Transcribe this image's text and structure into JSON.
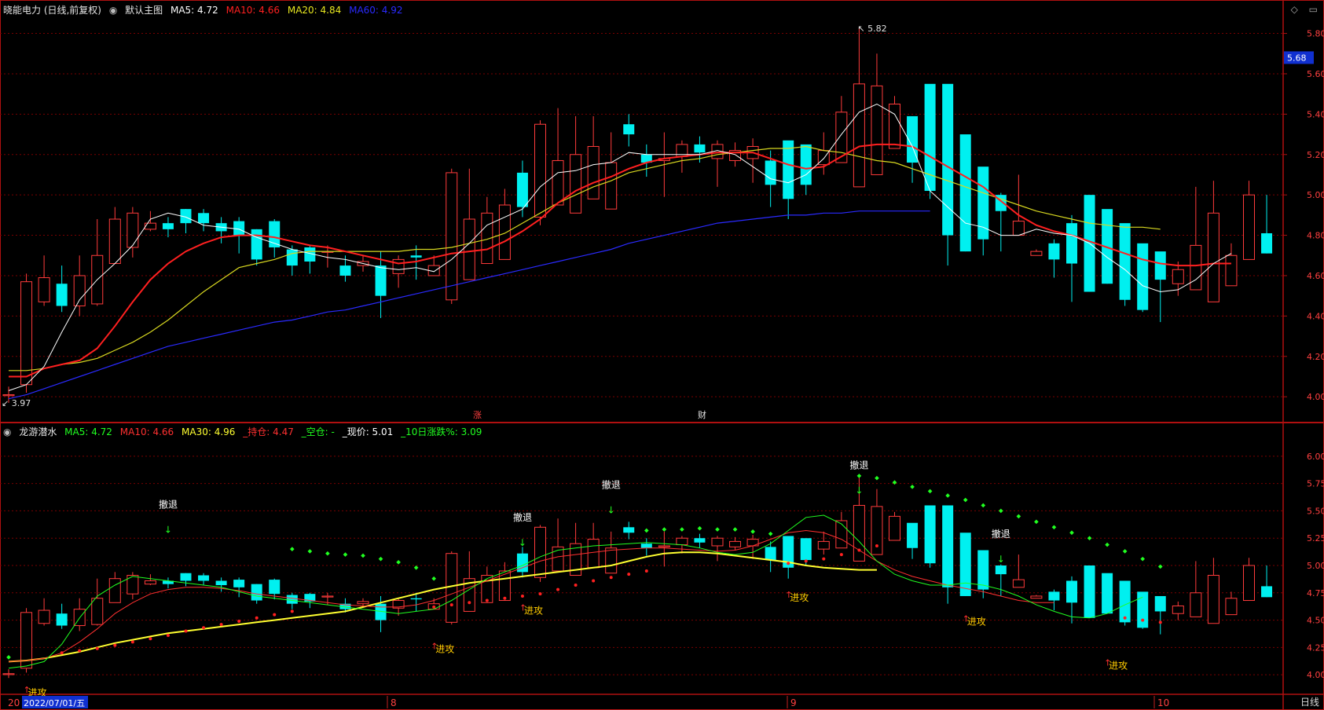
{
  "panel1": {
    "stock": "晓能电力 (日线,前复权)",
    "main_label": "默认主图",
    "ma": [
      {
        "label": "MA5: 4.72",
        "color": "#ffffff"
      },
      {
        "label": "MA10: 4.66",
        "color": "#ff2020"
      },
      {
        "label": "MA20: 4.84",
        "color": "#e8e820"
      },
      {
        "label": "MA60: 4.92",
        "color": "#2a2aff"
      }
    ],
    "markers": {
      "high": "5.82",
      "low": "3.97",
      "zhang": "涨",
      "cai": "财"
    },
    "price_tag": "5.68"
  },
  "panel2": {
    "title": "龙游潜水",
    "items": [
      {
        "label": "MA5: 4.72",
        "color": "#20ff20"
      },
      {
        "label": "MA10: 4.66",
        "color": "#ff3030"
      },
      {
        "label": "MA30: 4.96",
        "color": "#ffff30"
      },
      {
        "label": "_持仓: 4.47",
        "color": "#ff3030"
      },
      {
        "label": "_空仓: -",
        "color": "#20ff20"
      },
      {
        "label": "_现价: 5.01",
        "color": "#ffffff"
      },
      {
        "label": "_10日涨跌%: 3.09",
        "color": "#20ff20"
      }
    ],
    "attack": "进攻",
    "retreat": "撤退"
  },
  "xaxis": {
    "date": "2022/07/01/五",
    "months": [
      "8",
      "9",
      "10"
    ],
    "left_stub": "20"
  },
  "mode": "日线",
  "colors": {
    "up": "#ff3b3b",
    "down": "#00f0f0",
    "frame": "#b01010"
  },
  "chart_data": [
    {
      "type": "candlestick",
      "title": "晓能电力 (日线,前复权)",
      "ylim": [
        3.88,
        5.88
      ],
      "yticks": [
        4.0,
        4.2,
        4.4,
        4.6,
        4.8,
        5.0,
        5.2,
        5.4,
        5.6,
        5.8
      ],
      "x": [
        1,
        2,
        3,
        4,
        5,
        6,
        7,
        8,
        9,
        10,
        11,
        12,
        13,
        14,
        15,
        16,
        17,
        18,
        19,
        20,
        21,
        22,
        23,
        24,
        25,
        26,
        27,
        28,
        29,
        30,
        31,
        32,
        33,
        34,
        35,
        36,
        37,
        38,
        39,
        40,
        41,
        42,
        43,
        44,
        45,
        46,
        47,
        48,
        49,
        50,
        51,
        52,
        53,
        54,
        55,
        56,
        57,
        58,
        59,
        60,
        61,
        62,
        63,
        64,
        65,
        66,
        67,
        68,
        69,
        70,
        71,
        72
      ],
      "open": [
        4.01,
        4.06,
        4.47,
        4.56,
        4.45,
        4.46,
        4.66,
        4.74,
        4.83,
        4.86,
        4.93,
        4.91,
        4.86,
        4.87,
        4.83,
        4.87,
        4.73,
        4.74,
        4.72,
        4.65,
        4.65,
        4.65,
        4.61,
        4.7,
        4.6,
        4.48,
        4.58,
        4.66,
        4.68,
        5.11,
        4.89,
        4.95,
        4.91,
        4.98,
        4.93,
        5.35,
        5.2,
        5.17,
        5.19,
        5.25,
        5.18,
        5.17,
        5.18,
        5.17,
        5.27,
        5.25,
        5.15,
        5.16,
        5.04,
        5.1,
        5.23,
        5.39,
        5.55,
        5.55,
        5.3,
        5.14,
        5.0,
        4.8,
        4.7,
        4.76,
        4.86,
        5.0,
        4.93,
        4.86,
        4.76,
        4.72,
        4.56,
        4.53,
        4.47,
        4.55,
        4.68,
        4.81
      ],
      "close": [
        4.01,
        4.57,
        4.59,
        4.45,
        4.6,
        4.7,
        4.88,
        4.91,
        4.86,
        4.83,
        4.86,
        4.86,
        4.82,
        4.8,
        4.68,
        4.74,
        4.65,
        4.67,
        4.72,
        4.6,
        4.67,
        4.5,
        4.68,
        4.69,
        4.65,
        5.11,
        4.88,
        4.91,
        4.95,
        4.94,
        5.35,
        5.17,
        5.2,
        5.24,
        5.16,
        5.3,
        5.16,
        5.18,
        5.25,
        5.21,
        5.25,
        5.22,
        5.24,
        5.05,
        4.98,
        5.05,
        5.22,
        5.41,
        5.55,
        5.54,
        5.45,
        5.16,
        5.02,
        4.8,
        4.72,
        4.78,
        4.92,
        4.87,
        4.72,
        4.68,
        4.66,
        4.52,
        4.56,
        4.48,
        4.43,
        4.58,
        4.63,
        4.75,
        4.91,
        4.7,
        5.0,
        4.71
      ],
      "high": [
        4.05,
        4.61,
        4.7,
        4.65,
        4.7,
        4.88,
        4.94,
        4.94,
        4.92,
        4.89,
        4.93,
        4.93,
        4.89,
        4.89,
        4.83,
        4.88,
        4.75,
        4.75,
        4.75,
        4.7,
        4.7,
        4.72,
        4.7,
        4.75,
        4.7,
        5.13,
        5.13,
        4.99,
        5.03,
        5.17,
        5.37,
        5.43,
        5.39,
        5.39,
        5.31,
        5.4,
        5.25,
        5.31,
        5.27,
        5.29,
        5.27,
        5.26,
        5.28,
        5.22,
        5.25,
        5.11,
        5.31,
        5.49,
        5.83,
        5.7,
        5.49,
        5.3,
        5.1,
        4.87,
        4.8,
        4.89,
        5.01,
        5.1,
        4.73,
        4.78,
        4.9,
        4.74,
        4.66,
        4.54,
        4.49,
        4.68,
        4.67,
        5.04,
        5.07,
        4.76,
        5.07,
        5.0
      ],
      "low": [
        3.97,
        4.02,
        4.45,
        4.42,
        4.4,
        4.45,
        4.66,
        4.69,
        4.82,
        4.79,
        4.81,
        4.82,
        4.76,
        4.71,
        4.65,
        4.69,
        4.6,
        4.61,
        4.64,
        4.57,
        4.62,
        4.39,
        4.54,
        4.58,
        4.6,
        4.46,
        4.73,
        4.8,
        4.89,
        4.89,
        4.85,
        5.06,
        5.15,
        5.13,
        5.05,
        5.24,
        5.09,
        4.99,
        5.11,
        5.16,
        5.04,
        5.14,
        5.06,
        4.94,
        4.88,
        5.0,
        5.1,
        5.31,
        5.42,
        5.47,
        5.29,
        5.06,
        4.98,
        4.65,
        4.72,
        4.7,
        4.72,
        4.8,
        4.7,
        4.59,
        4.47,
        4.52,
        4.56,
        4.45,
        4.42,
        4.37,
        4.5,
        4.75,
        4.88,
        4.68,
        4.81,
        4.71
      ],
      "ma5": [
        4.03,
        4.06,
        4.15,
        4.32,
        4.48,
        4.58,
        4.66,
        4.75,
        4.88,
        4.91,
        4.89,
        4.85,
        4.84,
        4.83,
        4.79,
        4.76,
        4.73,
        4.71,
        4.69,
        4.68,
        4.66,
        4.64,
        4.63,
        4.64,
        4.62,
        4.68,
        4.76,
        4.85,
        4.89,
        4.93,
        5.04,
        5.11,
        5.12,
        5.15,
        5.16,
        5.21,
        5.2,
        5.2,
        5.2,
        5.2,
        5.22,
        5.2,
        5.14,
        5.08,
        5.06,
        5.1,
        5.18,
        5.3,
        5.41,
        5.45,
        5.4,
        5.24,
        5.02,
        4.94,
        4.86,
        4.84,
        4.8,
        4.8,
        4.83,
        4.81,
        4.8,
        4.76,
        4.69,
        4.63,
        4.55,
        4.52,
        4.53,
        4.58,
        4.66,
        4.71
      ],
      "ma10": [
        4.1,
        4.1,
        4.14,
        4.16,
        4.18,
        4.24,
        4.35,
        4.47,
        4.58,
        4.66,
        4.72,
        4.76,
        4.79,
        4.8,
        4.8,
        4.79,
        4.77,
        4.75,
        4.74,
        4.72,
        4.7,
        4.68,
        4.66,
        4.67,
        4.69,
        4.71,
        4.72,
        4.73,
        4.77,
        4.82,
        4.88,
        4.96,
        5.02,
        5.06,
        5.09,
        5.13,
        5.16,
        5.18,
        5.19,
        5.2,
        5.21,
        5.21,
        5.21,
        5.18,
        5.15,
        5.13,
        5.14,
        5.19,
        5.24,
        5.25,
        5.25,
        5.24,
        5.19,
        5.14,
        5.09,
        5.04,
        4.97,
        4.9,
        4.85,
        4.82,
        4.8,
        4.77,
        4.74,
        4.71,
        4.68,
        4.66,
        4.65,
        4.65,
        4.66,
        4.66
      ],
      "ma20": [
        4.13,
        4.13,
        4.14,
        4.16,
        4.17,
        4.19,
        4.23,
        4.27,
        4.32,
        4.38,
        4.45,
        4.52,
        4.58,
        4.64,
        4.66,
        4.68,
        4.71,
        4.72,
        4.72,
        4.72,
        4.72,
        4.72,
        4.72,
        4.73,
        4.73,
        4.74,
        4.76,
        4.78,
        4.81,
        4.86,
        4.91,
        4.96,
        5.0,
        5.04,
        5.07,
        5.11,
        5.13,
        5.15,
        5.17,
        5.18,
        5.2,
        5.21,
        5.22,
        5.23,
        5.23,
        5.24,
        5.22,
        5.21,
        5.19,
        5.17,
        5.16,
        5.13,
        5.1,
        5.07,
        5.04,
        5.01,
        4.98,
        4.95,
        4.92,
        4.9,
        4.88,
        4.86,
        4.85,
        4.84,
        4.84,
        4.83
      ],
      "ma60": [
        3.99,
        4.01,
        4.04,
        4.07,
        4.1,
        4.13,
        4.16,
        4.19,
        4.22,
        4.25,
        4.27,
        4.29,
        4.31,
        4.33,
        4.35,
        4.37,
        4.38,
        4.4,
        4.42,
        4.43,
        4.45,
        4.47,
        4.49,
        4.51,
        4.53,
        4.55,
        4.57,
        4.59,
        4.61,
        4.63,
        4.65,
        4.67,
        4.69,
        4.71,
        4.73,
        4.76,
        4.78,
        4.8,
        4.82,
        4.84,
        4.86,
        4.87,
        4.88,
        4.89,
        4.9,
        4.9,
        4.91,
        4.91,
        4.92,
        4.92,
        4.92,
        4.92,
        4.92
      ]
    },
    {
      "type": "candlestick",
      "title": "龙游潜水",
      "ylim": [
        3.85,
        6.15
      ],
      "yticks": [
        4.0,
        4.25,
        4.5,
        4.75,
        5.0,
        5.25,
        5.5,
        5.75,
        6.0
      ],
      "ma5": [
        4.06,
        4.08,
        4.12,
        4.28,
        4.52,
        4.72,
        4.82,
        4.9,
        4.88,
        4.86,
        4.84,
        4.82,
        4.8,
        4.76,
        4.72,
        4.7,
        4.68,
        4.66,
        4.64,
        4.62,
        4.6,
        4.58,
        4.56,
        4.58,
        4.6,
        4.68,
        4.78,
        4.88,
        4.94,
        5.0,
        5.08,
        5.14,
        5.16,
        5.18,
        5.19,
        5.2,
        5.21,
        5.2,
        5.19,
        5.16,
        5.12,
        5.1,
        5.12,
        5.2,
        5.32,
        5.44,
        5.46,
        5.38,
        5.22,
        5.04,
        4.92,
        4.86,
        4.82,
        4.82,
        4.84,
        4.82,
        4.78,
        4.72,
        4.64,
        4.58,
        4.53,
        4.52,
        4.56,
        4.64,
        4.71
      ],
      "ma10": [
        4.12,
        4.13,
        4.15,
        4.2,
        4.3,
        4.42,
        4.56,
        4.66,
        4.74,
        4.78,
        4.8,
        4.8,
        4.79,
        4.77,
        4.74,
        4.72,
        4.7,
        4.68,
        4.66,
        4.64,
        4.63,
        4.62,
        4.62,
        4.64,
        4.68,
        4.74,
        4.8,
        4.86,
        4.92,
        4.98,
        5.04,
        5.08,
        5.1,
        5.12,
        5.14,
        5.15,
        5.16,
        5.16,
        5.15,
        5.14,
        5.13,
        5.14,
        5.18,
        5.24,
        5.3,
        5.32,
        5.3,
        5.24,
        5.14,
        5.04,
        4.96,
        4.9,
        4.86,
        4.82,
        4.79,
        4.76,
        4.72,
        4.68,
        4.66,
        4.66
      ],
      "ma30": [
        4.12,
        4.13,
        4.15,
        4.18,
        4.21,
        4.25,
        4.29,
        4.32,
        4.35,
        4.38,
        4.4,
        4.42,
        4.44,
        4.46,
        4.48,
        4.5,
        4.52,
        4.54,
        4.56,
        4.58,
        4.62,
        4.66,
        4.7,
        4.74,
        4.78,
        4.81,
        4.84,
        4.86,
        4.88,
        4.9,
        4.92,
        4.94,
        4.96,
        4.98,
        5.0,
        5.04,
        5.08,
        5.11,
        5.12,
        5.12,
        5.11,
        5.09,
        5.07,
        5.05,
        5.03,
        5.0,
        4.98,
        4.97,
        4.96,
        4.96
      ]
    }
  ]
}
